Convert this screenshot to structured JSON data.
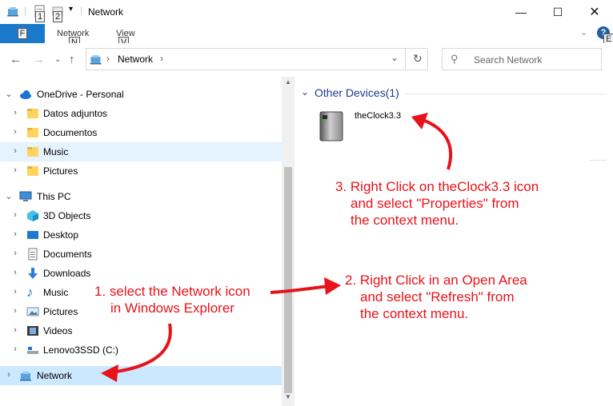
{
  "window": {
    "title": "Network",
    "keytips": [
      "1",
      "2",
      "N",
      "V",
      "E"
    ]
  },
  "ribbon": {
    "file_label": "F",
    "tabs": [
      "Network",
      "View"
    ]
  },
  "address": {
    "path_item": "Network",
    "search_placeholder": "Search Network"
  },
  "nav": {
    "items": [
      {
        "label": "OneDrive - Personal",
        "icon": "cloud-icon",
        "state": "expanded"
      },
      {
        "label": "Datos adjuntos",
        "icon": "folder-icon",
        "state": "collapsed"
      },
      {
        "label": "Documentos",
        "icon": "folder-icon",
        "state": "collapsed"
      },
      {
        "label": "Music",
        "icon": "folder-icon",
        "state": "collapsed"
      },
      {
        "label": "Pictures",
        "icon": "folder-icon",
        "state": "collapsed"
      },
      {
        "label": "This PC",
        "icon": "monitor-icon",
        "state": "expanded"
      },
      {
        "label": "3D Objects",
        "icon": "cube-icon",
        "state": "collapsed"
      },
      {
        "label": "Desktop",
        "icon": "desktop-icon",
        "state": "collapsed"
      },
      {
        "label": "Documents",
        "icon": "documents-icon",
        "state": "collapsed"
      },
      {
        "label": "Downloads",
        "icon": "download-icon",
        "state": "collapsed"
      },
      {
        "label": "Music",
        "icon": "music-icon",
        "state": "collapsed"
      },
      {
        "label": "Pictures",
        "icon": "pictures-icon",
        "state": "collapsed"
      },
      {
        "label": "Videos",
        "icon": "videos-icon",
        "state": "collapsed"
      },
      {
        "label": "Lenovo3SSD (C:)",
        "icon": "drive-icon",
        "state": "collapsed"
      },
      {
        "label": "Network",
        "icon": "network-icon",
        "state": "collapsed"
      }
    ]
  },
  "content": {
    "group_label": "Other Devices(1)",
    "device_name": "theClock3.3"
  },
  "annotations": {
    "step1": [
      "1. select the Network icon",
      "in Windows Explorer"
    ],
    "step2": [
      "2. Right Click in an Open Area",
      "and select \"Refresh\" from",
      "the context menu."
    ],
    "step3": [
      "3. Right Click on theClock3.3 icon",
      "and select \"Properties\" from",
      "the context menu."
    ]
  },
  "colors": {
    "accent": "#1979ca",
    "selection": "#cce8ff",
    "annotation": "#e8121a",
    "group_header": "#1e3d8f"
  }
}
